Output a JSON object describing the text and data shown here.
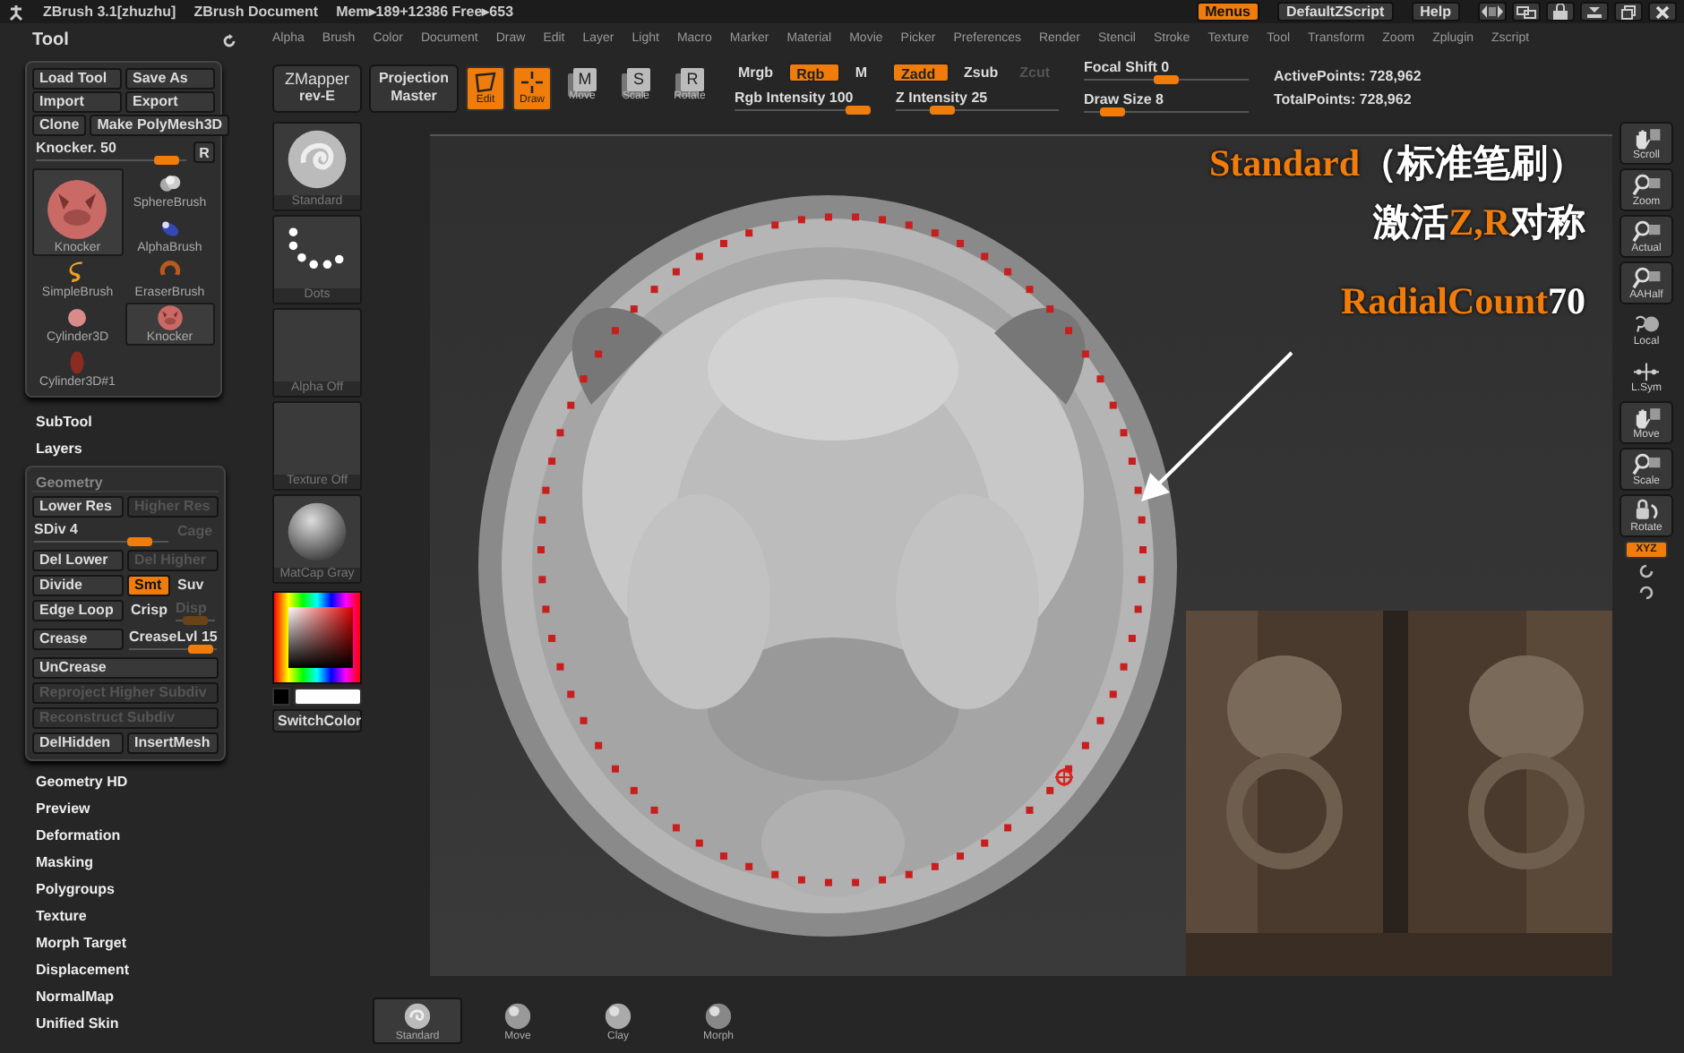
{
  "title_bar": {
    "app": "ZBrush  3.1[zhuzhu]",
    "document": "ZBrush Document",
    "memory": "Mem▸189+12386 Free▸653",
    "buttons": [
      {
        "label": "Menus",
        "selected": true
      },
      {
        "label": "DefaultZScript",
        "selected": false
      },
      {
        "label": "Help",
        "selected": false
      }
    ]
  },
  "tool_palette": {
    "title": "Tool",
    "buttons": [
      [
        "Load Tool",
        "Save As"
      ],
      [
        "Import",
        "Export"
      ],
      [
        "Clone",
        "Make PolyMesh3D"
      ]
    ],
    "slider": {
      "label": "Knocker. 50",
      "level": 0.95
    },
    "reset_button": "R",
    "tool_columns": [
      [
        {
          "label": "Knocker",
          "kind": "knocker",
          "large": true,
          "selected": true
        },
        {
          "label": "SimpleBrush",
          "kind": "simple",
          "large": false,
          "selected": false
        },
        {
          "label": "Cylinder3D",
          "kind": "cylinder",
          "large": false,
          "selected": false
        },
        {
          "label": "Cylinder3D#1",
          "kind": "cylinder_flat",
          "large": false,
          "selected": false
        }
      ],
      [
        {
          "label": "SphereBrush",
          "kind": "sphere",
          "large": false,
          "selected": false
        },
        {
          "label": "AlphaBrush",
          "kind": "alpha",
          "large": false,
          "selected": false
        },
        {
          "label": "EraserBrush",
          "kind": "eraser",
          "large": false,
          "selected": false
        },
        {
          "label": "Knocker",
          "kind": "knocker",
          "large": false,
          "selected": true
        }
      ]
    ]
  },
  "sections_before": [
    "SubTool",
    "Layers"
  ],
  "geometry": {
    "title": "Geometry",
    "controls": [
      {
        "kind": "button",
        "label": "Lower Res",
        "disabled": false,
        "on": false
      },
      {
        "kind": "button",
        "label": "Higher Res",
        "disabled": true,
        "on": false
      },
      {
        "kind": "slider_long",
        "label": "SDiv 4",
        "level": 0.85,
        "disabled": false
      },
      {
        "kind": "toggle",
        "label": "Cage",
        "disabled": true,
        "on": false
      },
      {
        "kind": "button",
        "label": "Del Lower",
        "disabled": false,
        "on": false
      },
      {
        "kind": "button",
        "label": "Del Higher",
        "disabled": true,
        "on": false
      },
      {
        "kind": "button",
        "label": "Divide",
        "disabled": false,
        "on": false
      },
      {
        "kind": "small_button",
        "label": "Smt",
        "disabled": false,
        "on": true
      },
      {
        "kind": "toggle",
        "label": "Suv",
        "disabled": false,
        "on": false
      },
      {
        "kind": "button",
        "label": "Edge Loop",
        "disabled": false,
        "on": false
      },
      {
        "kind": "toggle",
        "label": "Crisp",
        "disabled": false,
        "on": false
      },
      {
        "kind": "slider_short",
        "label": "Disp",
        "level": 0.5,
        "disabled": true
      },
      {
        "kind": "button",
        "label": "Crease",
        "disabled": false,
        "on": false
      },
      {
        "kind": "slider",
        "label": "CreaseLvl 15",
        "level": 0.95,
        "disabled": false
      },
      {
        "kind": "wide",
        "label": "UnCrease",
        "disabled": false,
        "on": false
      },
      {
        "kind": "wide",
        "label": "Reproject Higher Subdiv",
        "disabled": true,
        "on": false
      },
      {
        "kind": "wide",
        "label": "Reconstruct Subdiv",
        "disabled": true,
        "on": false
      },
      {
        "kind": "button",
        "label": "DelHidden",
        "disabled": false,
        "on": false
      },
      {
        "kind": "button",
        "label": "InsertMesh",
        "disabled": false,
        "on": false
      }
    ]
  },
  "sections_after": [
    "Geometry HD",
    "Preview",
    "Deformation",
    "Masking",
    "Polygroups",
    "Texture",
    "Morph Target",
    "Displacement",
    "NormalMap",
    "Unified Skin"
  ],
  "menu_bar": [
    "Alpha",
    "Brush",
    "Color",
    "Document",
    "Draw",
    "Edit",
    "Layer",
    "Light",
    "Macro",
    "Marker",
    "Material",
    "Movie",
    "Picker",
    "Preferences",
    "Render",
    "Stencil",
    "Stroke",
    "Texture",
    "Tool",
    "Transform",
    "Zoom",
    "Zplugin",
    "Zscript"
  ],
  "toolbar": {
    "zmapper": {
      "title": "ZMapper",
      "subtitle": "rev-E"
    },
    "projection": {
      "title": "Projection",
      "subtitle": "Master"
    },
    "modes": [
      {
        "label": "Edit",
        "kind": "edit",
        "selected": true
      },
      {
        "label": "Draw",
        "kind": "draw",
        "selected": true
      },
      {
        "label": "Move",
        "kind": "letter",
        "glyph": "M",
        "selected": false
      },
      {
        "label": "Scale",
        "kind": "letter",
        "glyph": "S",
        "selected": false
      },
      {
        "label": "Rotate",
        "kind": "letter",
        "glyph": "R",
        "selected": false
      }
    ],
    "rgb_toggles": [
      {
        "label": "Mrgb",
        "on": false
      },
      {
        "label": "Rgb",
        "on": true
      },
      {
        "label": "M",
        "on": false
      }
    ],
    "rgb_intensity": {
      "label": "Rgb Intensity 100",
      "level": 1
    },
    "z_toggles": [
      {
        "label": "Zadd",
        "on": true,
        "disabled": false
      },
      {
        "label": "Zsub",
        "on": false,
        "disabled": false
      },
      {
        "label": "Zcut",
        "on": false,
        "disabled": true
      }
    ],
    "z_intensity": {
      "label": "Z Intensity 25",
      "level": 0.25
    },
    "focal_shift": {
      "label": "Focal Shift 0",
      "level": 0.5
    },
    "draw_size": {
      "label": "Draw Size 8",
      "level": 0.12
    },
    "stats": [
      "ActivePoints: 728,962",
      "TotalPoints: 728,962"
    ]
  },
  "left_shelf": {
    "items": [
      {
        "label": "Standard",
        "kind": "standard"
      },
      {
        "label": "Dots",
        "kind": "dots"
      },
      {
        "label": "Alpha Off",
        "kind": "empty"
      },
      {
        "label": "Texture Off",
        "kind": "empty"
      },
      {
        "label": "MatCap Gray",
        "kind": "sphere"
      }
    ],
    "switch_color": "SwitchColor"
  },
  "canvas": {
    "annotations": [
      {
        "parts": [
          {
            "text": "Standard",
            "highlight": true
          },
          {
            "text": "（标准笔刷）",
            "highlight": false
          }
        ]
      },
      {
        "parts": [
          {
            "text": "激活",
            "highlight": false
          },
          {
            "text": "Z,R",
            "highlight": true
          },
          {
            "text": "对称",
            "highlight": false
          }
        ]
      },
      {
        "parts": [
          {
            "text": "RadialCount",
            "highlight": true
          },
          {
            "text": " 70",
            "highlight": false
          }
        ]
      }
    ]
  },
  "right_shelf": {
    "items": [
      {
        "label": "Scroll",
        "kind": "hand",
        "framed": true
      },
      {
        "label": "Zoom",
        "kind": "magnify",
        "framed": true
      },
      {
        "label": "Actual",
        "kind": "magnify",
        "framed": true
      },
      {
        "label": "AAHalf",
        "kind": "magnify",
        "framed": true
      },
      {
        "label": "Local",
        "kind": "local",
        "framed": false
      },
      {
        "label": "L.Sym",
        "kind": "lsym",
        "framed": false
      },
      {
        "label": "Move",
        "kind": "hand",
        "framed": true
      },
      {
        "label": "Scale",
        "kind": "magnify",
        "framed": true
      },
      {
        "label": "Rotate",
        "kind": "rotate",
        "framed": true
      }
    ],
    "xyz": {
      "label": "XYZ",
      "on": true
    }
  },
  "bottom_bar": [
    {
      "label": "Standard",
      "kind": "standard",
      "selected": true
    },
    {
      "label": "Move",
      "kind": "move",
      "selected": false
    },
    {
      "label": "Clay",
      "kind": "clay",
      "selected": false
    },
    {
      "label": "Morph",
      "kind": "morph",
      "selected": false
    }
  ]
}
